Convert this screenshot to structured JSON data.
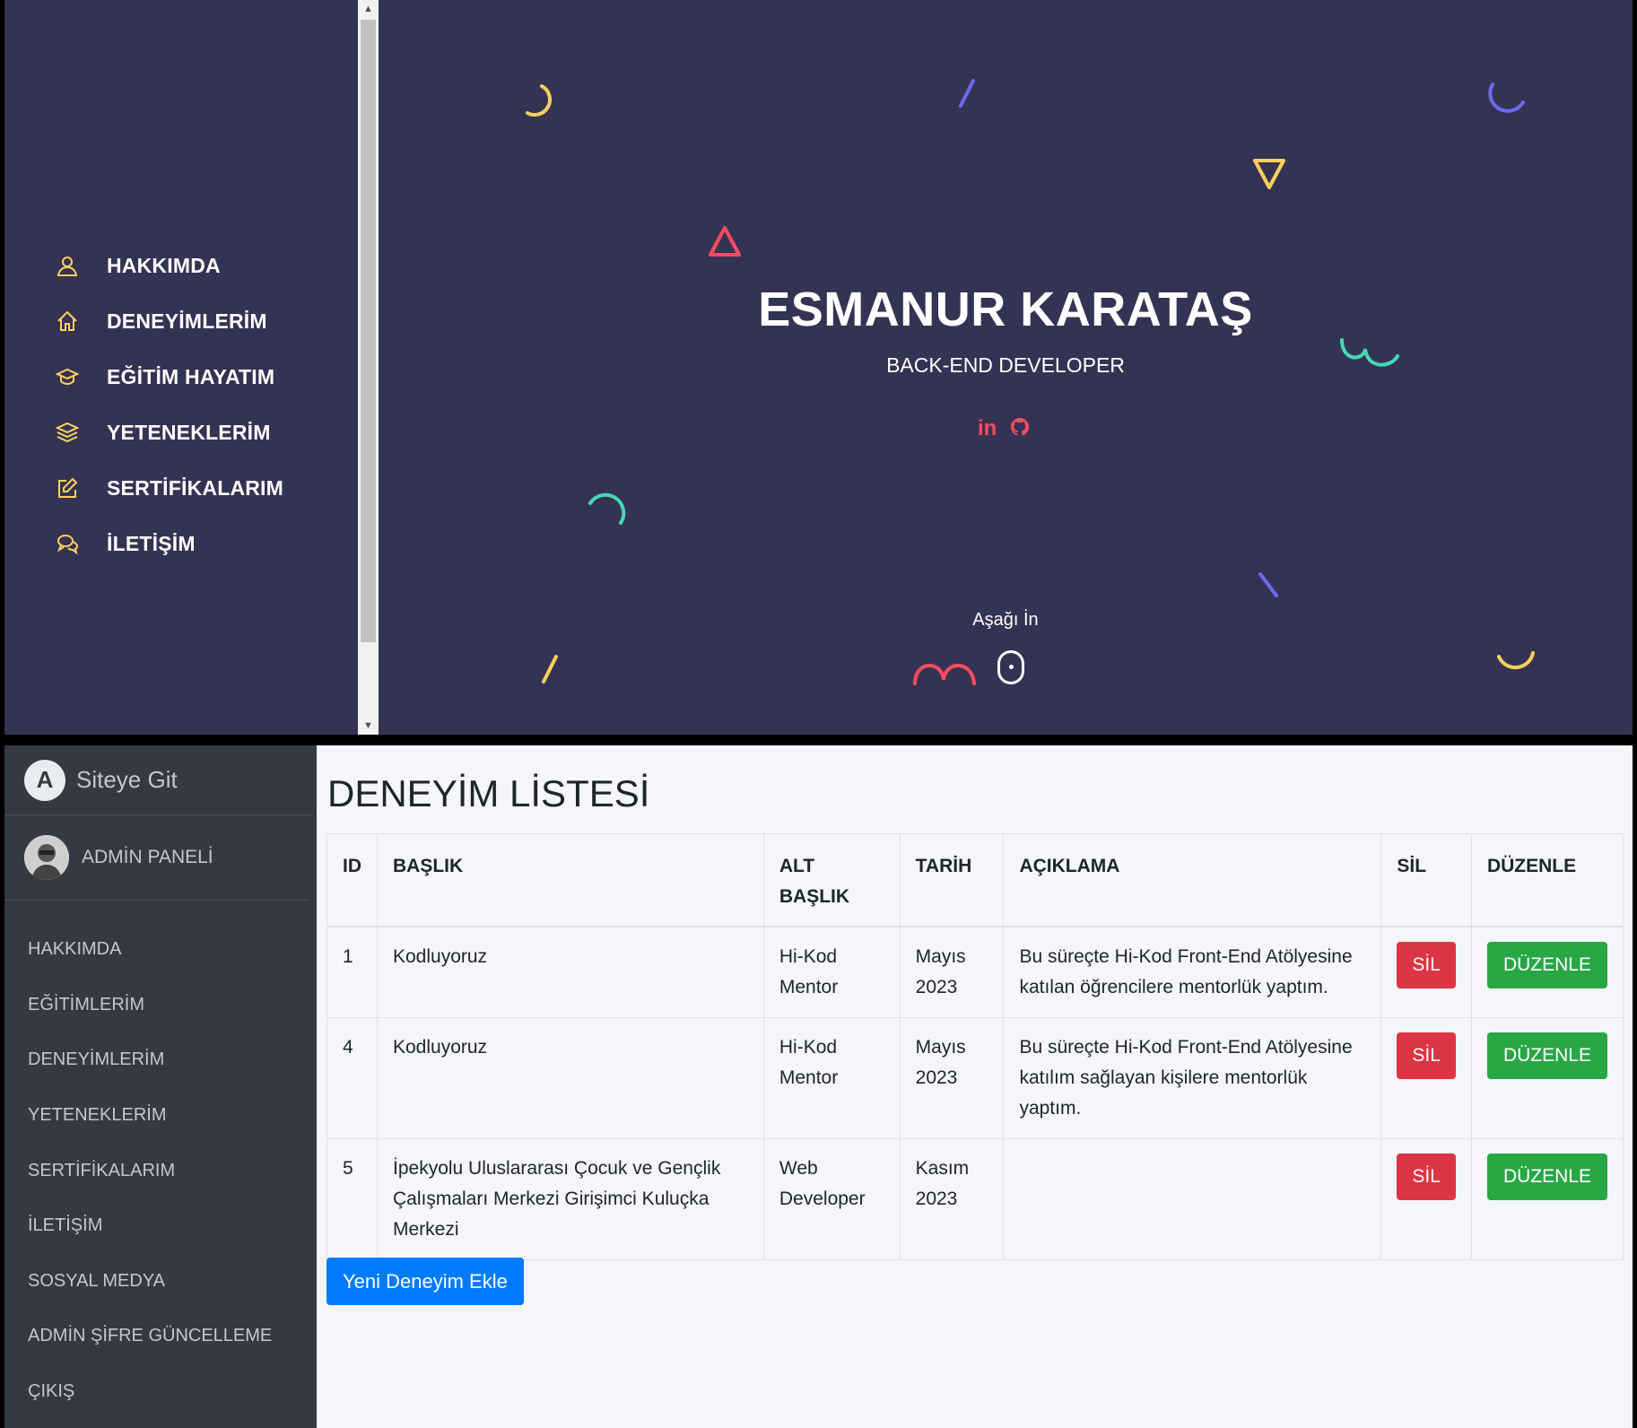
{
  "portfolio": {
    "nav": [
      {
        "label": "HAKKIMDA",
        "icon": "user-icon"
      },
      {
        "label": "DENEYİMLERİM",
        "icon": "home-icon"
      },
      {
        "label": "EĞİTİM HAYATIM",
        "icon": "graduation-cap-icon"
      },
      {
        "label": "YETENEKLERİM",
        "icon": "layers-icon"
      },
      {
        "label": "SERTİFİKALARIM",
        "icon": "edit-icon"
      },
      {
        "label": "İLETİŞİM",
        "icon": "chat-icon"
      }
    ],
    "hero": {
      "name": "ESMANUR KARATAŞ",
      "role": "BACK-END DEVELOPER",
      "social": [
        {
          "label": "in",
          "icon": "linkedin-icon"
        },
        {
          "label": "github",
          "icon": "github-icon"
        }
      ],
      "scroll_label": "Aşağı İn"
    },
    "colors": {
      "background": "#353353",
      "accent": "#ff4c60",
      "nav_icon": "#ffd15c"
    }
  },
  "admin": {
    "brand": "Siteye Git",
    "user": "ADMİN PANELİ",
    "nav": [
      "HAKKIMDA",
      "EĞİTİMLERİM",
      "DENEYİMLERİM",
      "YETENEKLERİM",
      "SERTİFİKALARIM",
      "İLETİŞİM",
      "SOSYAL MEDYA",
      "ADMİN ŞİFRE GÜNCELLEME",
      "ÇIKIŞ"
    ],
    "title": "DENEYİM LİSTESİ",
    "table": {
      "headers": [
        "ID",
        "BAŞLIK",
        "ALT BAŞLIK",
        "TARİH",
        "AÇIKLAMA",
        "SİL",
        "DÜZENLE"
      ],
      "rows": [
        {
          "id": "1",
          "title": "Kodluyoruz",
          "subtitle": "Hi-Kod Mentor",
          "date": "Mayıs 2023",
          "description": "Bu süreçte Hi-Kod Front-End Atölyesine katılan öğrencilere mentorlük yaptım.",
          "delete": "SİL",
          "edit": "DÜZENLE"
        },
        {
          "id": "4",
          "title": "Kodluyoruz",
          "subtitle": "Hi-Kod Mentor",
          "date": "Mayıs 2023",
          "description": "Bu süreçte Hi-Kod Front-End Atölyesine katılım sağlayan kişilere mentorlük yaptım.",
          "delete": "SİL",
          "edit": "DÜZENLE"
        },
        {
          "id": "5",
          "title": "İpekyolu Uluslararası Çocuk ve Gençlik Çalışmaları Merkezi Girişimci Kuluçka Merkezi",
          "subtitle": "Web Developer",
          "date": "Kasım 2023",
          "description": "",
          "delete": "SİL",
          "edit": "DÜZENLE"
        }
      ]
    },
    "add_button": "Yeni Deneyim Ekle",
    "colors": {
      "sidebar": "#343a40",
      "danger": "#dc3545",
      "success": "#28a745",
      "primary": "#007bff"
    }
  }
}
